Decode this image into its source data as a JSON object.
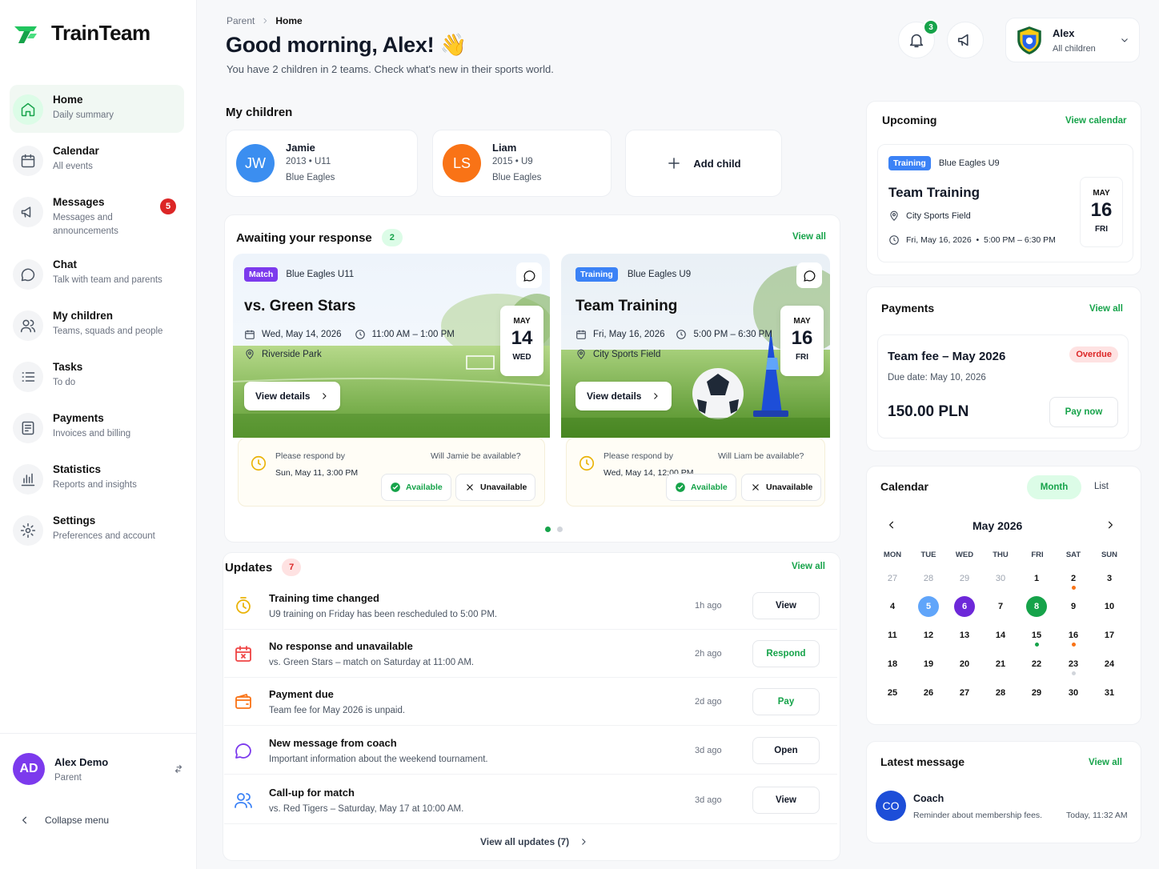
{
  "app": {
    "name": "TrainTeam"
  },
  "nav": [
    {
      "title": "Home",
      "sub": "Daily summary",
      "icon": "home-icon",
      "active": true
    },
    {
      "title": "Calendar",
      "sub": "All events",
      "icon": "calendar-icon"
    },
    {
      "title": "Messages",
      "sub": "Messages and announcements",
      "icon": "megaphone-icon",
      "badge": "5"
    },
    {
      "title": "Chat",
      "sub": "Talk with team and parents",
      "icon": "chat-icon"
    },
    {
      "title": "My children",
      "sub": "Teams, squads and people",
      "icon": "users-icon"
    },
    {
      "title": "Tasks",
      "sub": "To do",
      "icon": "list-icon"
    },
    {
      "title": "Payments",
      "sub": "Invoices and billing",
      "icon": "invoice-icon"
    },
    {
      "title": "Statistics",
      "sub": "Reports and insights",
      "icon": "chart-icon"
    },
    {
      "title": "Settings",
      "sub": "Preferences and account",
      "icon": "gear-icon"
    }
  ],
  "user": {
    "initials": "AD",
    "name": "Alex Demo",
    "role": "Parent",
    "collapse": "Collapse menu"
  },
  "header": {
    "breadcrumb": [
      "Parent",
      "Home"
    ],
    "greeting": "Good morning, Alex! 👋",
    "subtitle": "You have 2 children in 2 teams. Check what's new in their sports world.",
    "notifications": "3",
    "profile_name": "Alex",
    "profile_sub": "All children"
  },
  "children": {
    "title": "My children",
    "items": [
      {
        "initials": "JW",
        "name": "Jamie",
        "meta": "2013 • U11",
        "team": "Blue Eagles",
        "color": "#3b8ef0"
      },
      {
        "initials": "LS",
        "name": "Liam",
        "meta": "2015 • U9",
        "team": "Blue Eagles",
        "color": "#f97316"
      }
    ],
    "add_label": "Add child"
  },
  "awaiting": {
    "title": "Awaiting your response",
    "count": "2",
    "view_all": "View all",
    "events": [
      {
        "tag": "Match",
        "team": "Blue Eagles U11",
        "title": "vs. Green Stars",
        "date": "Wed, May 14, 2026",
        "time": "11:00 AM – 1:00 PM",
        "place": "Riverside Park",
        "month": "MAY",
        "day": "14",
        "weekday": "WED",
        "details": "View details",
        "respond_label": "Please respond by",
        "respond_by": "Sun, May 11, 3:00 PM",
        "question": "Will Jamie be available?",
        "available": "Available",
        "unavailable": "Unavailable"
      },
      {
        "tag": "Training",
        "team": "Blue Eagles U9",
        "title": "Team Training",
        "date": "Fri, May 16, 2026",
        "time": "5:00 PM – 6:30 PM",
        "place": "City Sports Field",
        "month": "MAY",
        "day": "16",
        "weekday": "FRI",
        "details": "View details",
        "respond_label": "Please respond by",
        "respond_by": "Wed, May 14, 12:00 PM",
        "question": "Will Liam be available?",
        "available": "Available",
        "unavailable": "Unavailable"
      }
    ]
  },
  "updates": {
    "title": "Updates",
    "count": "7",
    "view_all": "View all",
    "footer": "View all updates (7)",
    "items": [
      {
        "icon": "clock-icon",
        "title": "Training time changed",
        "desc": "U9 training on Friday has been rescheduled to 5:00 PM.",
        "time": "1h ago",
        "action": "View"
      },
      {
        "icon": "calendar-x-icon",
        "title": "No response and unavailable",
        "desc": "vs. Green Stars – match on Saturday at 11:00 AM.",
        "time": "2h ago",
        "action": "Respond"
      },
      {
        "icon": "wallet-icon",
        "title": "Payment due",
        "desc": "Team fee for May 2026 is unpaid.",
        "time": "2d ago",
        "action": "Pay"
      },
      {
        "icon": "message-icon",
        "title": "New message from coach",
        "desc": "Important information about the weekend tournament.",
        "time": "3d ago",
        "action": "Open"
      },
      {
        "icon": "users-icon",
        "title": "Call-up for match",
        "desc": "vs. Red Tigers – Saturday, May 17 at 10:00 AM.",
        "time": "3d ago",
        "action": "View"
      }
    ]
  },
  "upcoming": {
    "title": "Upcoming",
    "link": "View calendar",
    "tag": "Training",
    "team": "Blue Eagles U9",
    "event": "Team Training",
    "place": "City Sports Field",
    "when": "Fri, May 16, 2026  •  5:00 PM – 6:30 PM",
    "month": "MAY",
    "day": "16",
    "weekday": "FRI"
  },
  "payments": {
    "title": "Payments",
    "link": "View all",
    "item": "Team fee – May 2026",
    "status": "Overdue",
    "due": "Due date: May 10, 2026",
    "amount": "150.00 PLN",
    "action": "Pay now"
  },
  "calendar": {
    "title": "Calendar",
    "view_month": "Month",
    "view_list": "List",
    "month_label": "May 2026",
    "weekdays": [
      "MON",
      "TUE",
      "WED",
      "THU",
      "FRI",
      "SAT",
      "SUN"
    ],
    "weeks": [
      [
        "27",
        "28",
        "29",
        "30",
        "1",
        "2",
        "3"
      ],
      [
        "4",
        "5",
        "6",
        "7",
        "8",
        "9",
        "10"
      ],
      [
        "11",
        "12",
        "13",
        "14",
        "15",
        "16",
        "17"
      ],
      [
        "18",
        "19",
        "20",
        "21",
        "22",
        "23",
        "24"
      ],
      [
        "25",
        "26",
        "27",
        "28",
        "29",
        "30",
        "31"
      ]
    ]
  },
  "latest": {
    "title": "Latest message",
    "link": "View all",
    "initials": "CO",
    "sender": "Coach",
    "text": "Reminder about membership fees.",
    "time": "Today, 11:32 AM"
  }
}
